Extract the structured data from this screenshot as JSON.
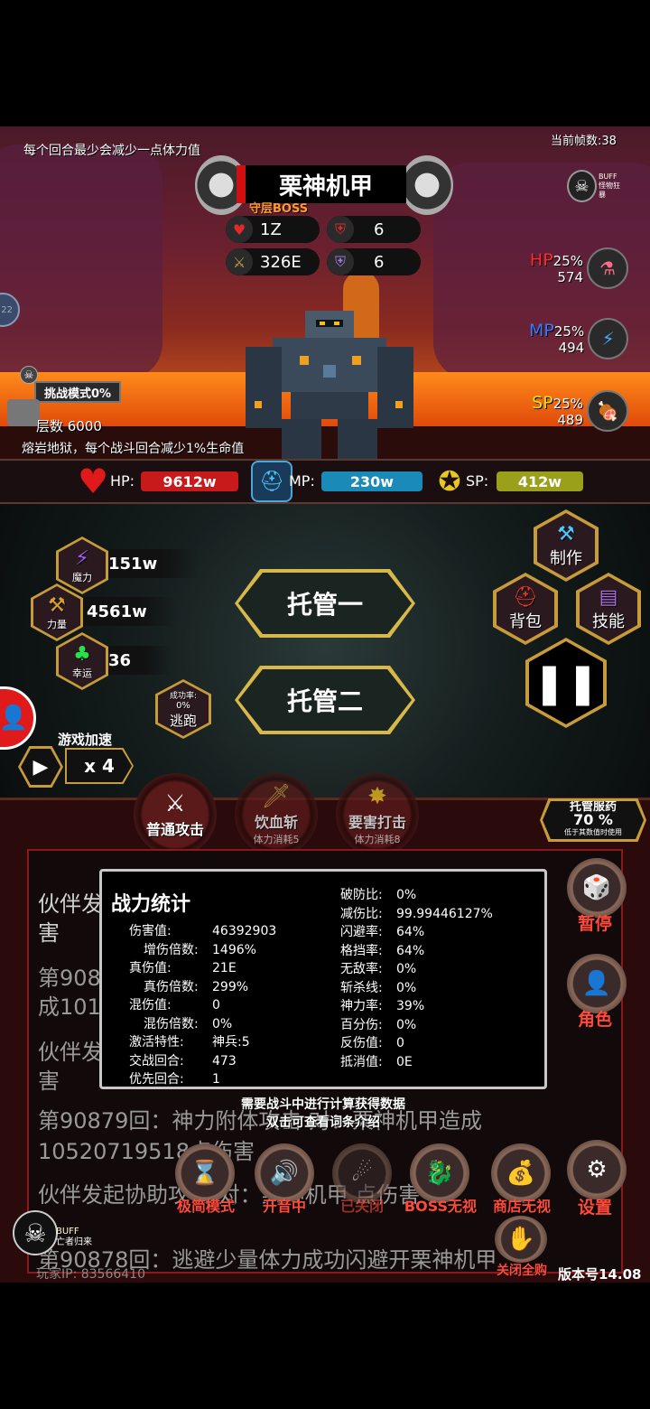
{
  "top": {
    "hint_top": "每个回合最少会减少一点体力值",
    "fps": "当前帧数:38",
    "boss_name": "栗神机甲",
    "boss_tag": "守层BOSS",
    "boss_stats": {
      "hp": "1Z",
      "def": "6",
      "atk": "326E",
      "mdef": "6"
    },
    "buff_label": "BUFF",
    "buff_sub": "怪物狂暴",
    "hp_res": {
      "label": "HP",
      "pct": "25%",
      "value": "574"
    },
    "mp_res": {
      "label": "MP",
      "pct": "25%",
      "value": "494"
    },
    "sp_res": {
      "label": "SP",
      "pct": "25%",
      "value": "489"
    },
    "side_tab": "22",
    "challenge": "挑战模式0%",
    "floor": "层数 6000",
    "floor_hint": "熔岩地狱，每个战斗回合减少1%生命值"
  },
  "status": {
    "hp_label": "HP:",
    "hp_value": "9612w",
    "mp_label": "MP:",
    "mp_value": "230w",
    "sp_label": "SP:",
    "sp_value": "412w"
  },
  "middle": {
    "magic_label": "魔力",
    "magic_value": "151w",
    "power_label": "力量",
    "power_value": "4561w",
    "luck_label": "幸运",
    "luck_value": "36",
    "escape_rate_label": "成功率:",
    "escape_rate": "0%",
    "escape_label": "逃跑",
    "auto1": "托管一",
    "auto2": "托管二",
    "craft": "制作",
    "bag": "背包",
    "skill": "技能",
    "speed_label": "游戏加速",
    "speed_value": "x 4"
  },
  "skills": {
    "normal": "普通攻击",
    "blood": "饮血斩",
    "blood_cost": "体力消耗5",
    "crit": "要害打击",
    "crit_cost": "体力消耗8",
    "potion_title": "托管服药",
    "potion_pct": "70 %",
    "potion_sub": "低于其数值时使用"
  },
  "stats_panel": {
    "title": "战力统计",
    "left": [
      {
        "k": "伤害值:",
        "v": "46392903"
      },
      {
        "k": "增伤倍数:",
        "v": "1496%"
      },
      {
        "k": "真伤值:",
        "v": "21E"
      },
      {
        "k": "真伤倍数:",
        "v": "299%"
      },
      {
        "k": "混伤值:",
        "v": "0"
      },
      {
        "k": "混伤倍数:",
        "v": "0%"
      },
      {
        "k": "激活特性:",
        "v": "神兵:5"
      },
      {
        "k": "交战回合:",
        "v": "473"
      },
      {
        "k": "优先回合:",
        "v": "1"
      }
    ],
    "right": [
      {
        "k": "破防比:",
        "v": "0%"
      },
      {
        "k": "减伤比:",
        "v": "99.99446127%"
      },
      {
        "k": "闪避率:",
        "v": "64%"
      },
      {
        "k": "格挡率:",
        "v": "64%"
      },
      {
        "k": "无敌率:",
        "v": "0%"
      },
      {
        "k": "斩杀线:",
        "v": "0%"
      },
      {
        "k": "神力率:",
        "v": "39%"
      },
      {
        "k": "百分伤:",
        "v": "0%"
      },
      {
        "k": "反伤值:",
        "v": "0"
      },
      {
        "k": "抵消值:",
        "v": "0E"
      }
    ],
    "note1": "需要战斗中进行计算获得数据",
    "note2": "双击可查看词条介绍"
  },
  "log": {
    "line1": "伙伴发",
    "line1b": "害",
    "line2": "第908",
    "line2b": "成101",
    "line3": "伙伴发",
    "line3b": "害",
    "line4": "第90879回：神力附体攻击 对：栗神机甲造成",
    "line5": "10520719518点伤害",
    "line6": "伙伴发起协助攻击 对：栗神机甲 点伤害",
    "line7": "第90878回：逃避少量体力成功闪避开栗神机甲"
  },
  "bottom": {
    "pause": "暂停",
    "role": "角色",
    "simple": "极简模式",
    "sound": "开音中",
    "closed": "已关闭",
    "boss_ignore": "BOSS无视",
    "shop_ignore": "商店无视",
    "settings": "设置",
    "close_buy": "关闭全购",
    "version": "版本号14.08",
    "player_ip": "玩家IP: 83566410",
    "buff_label": "BUFF",
    "buff_sub": "亡者归来"
  },
  "colors": {
    "hp": "#d01a1a",
    "mp": "#1a8ab8",
    "sp": "#9aa01a",
    "accent": "#ff4a3a",
    "gold": "#d8b848"
  }
}
